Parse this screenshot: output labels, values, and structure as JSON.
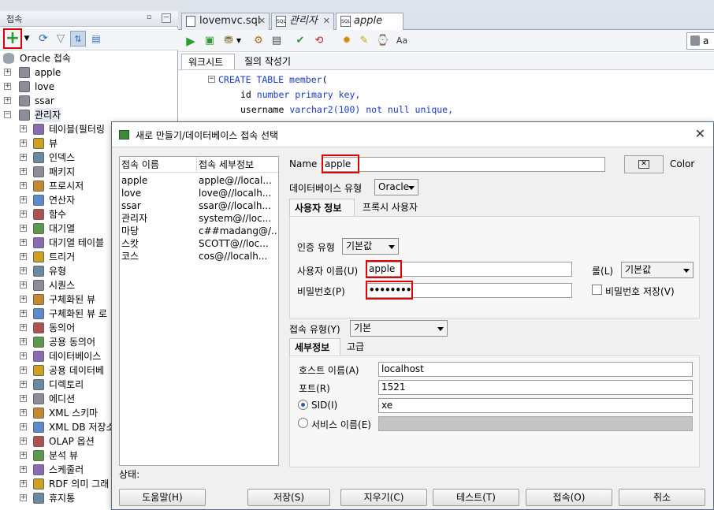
{
  "connections_panel": {
    "title": "접속",
    "minimize": "－",
    "tree": [
      {
        "label": "Oracle 접속",
        "level": 0,
        "icon": "database-icon",
        "expander": ""
      },
      {
        "label": "apple",
        "level": 1,
        "icon": "connection-icon",
        "expander": "+"
      },
      {
        "label": "love",
        "level": 1,
        "icon": "connection-icon",
        "expander": "+"
      },
      {
        "label": "ssar",
        "level": 1,
        "icon": "connection-icon",
        "expander": "+"
      },
      {
        "label": "관리자",
        "level": 1,
        "icon": "connection-icon",
        "expander": "−"
      },
      {
        "label": "테이블(필터링",
        "level": 2,
        "icon": "table-icon",
        "expander": "+"
      },
      {
        "label": "뷰",
        "level": 2,
        "icon": "view-icon",
        "expander": "+"
      },
      {
        "label": "인덱스",
        "level": 2,
        "icon": "index-icon",
        "expander": "+"
      },
      {
        "label": "패키지",
        "level": 2,
        "icon": "package-icon",
        "expander": "+"
      },
      {
        "label": "프로시저",
        "level": 2,
        "icon": "procedure-icon",
        "expander": "+"
      },
      {
        "label": "연산자",
        "level": 2,
        "icon": "operator-icon",
        "expander": "+"
      },
      {
        "label": "함수",
        "level": 2,
        "icon": "function-icon",
        "expander": "+"
      },
      {
        "label": "대기열",
        "level": 2,
        "icon": "queue-icon",
        "expander": "+"
      },
      {
        "label": "대기열 테이블",
        "level": 2,
        "icon": "queue-table-icon",
        "expander": "+"
      },
      {
        "label": "트리거",
        "level": 2,
        "icon": "trigger-icon",
        "expander": "+"
      },
      {
        "label": "유형",
        "level": 2,
        "icon": "type-icon",
        "expander": "+"
      },
      {
        "label": "시퀀스",
        "level": 2,
        "icon": "sequence-icon",
        "expander": "+"
      },
      {
        "label": "구체화된 뷰",
        "level": 2,
        "icon": "mview-icon",
        "expander": "+"
      },
      {
        "label": "구체화된 뷰 로",
        "level": 2,
        "icon": "mview-log-icon",
        "expander": "+"
      },
      {
        "label": "동의어",
        "level": 2,
        "icon": "synonym-icon",
        "expander": "+"
      },
      {
        "label": "공용 동의어",
        "level": 2,
        "icon": "public-synonym-icon",
        "expander": "+"
      },
      {
        "label": "데이터베이스",
        "level": 2,
        "icon": "db-link-icon",
        "expander": "+"
      },
      {
        "label": "공용 데이터베",
        "level": 2,
        "icon": "public-db-link-icon",
        "expander": "+"
      },
      {
        "label": "디렉토리",
        "level": 2,
        "icon": "directory-icon",
        "expander": "+"
      },
      {
        "label": "에디션",
        "level": 2,
        "icon": "edition-icon",
        "expander": "+"
      },
      {
        "label": "XML 스키마",
        "level": 2,
        "icon": "xml-schema-icon",
        "expander": "+"
      },
      {
        "label": "XML DB 저장소",
        "level": 2,
        "icon": "xml-db-icon",
        "expander": "+"
      },
      {
        "label": "OLAP 옵션",
        "level": 2,
        "icon": "olap-icon",
        "expander": "+"
      },
      {
        "label": "분석 뷰",
        "level": 2,
        "icon": "analytic-view-icon",
        "expander": "+"
      },
      {
        "label": "스케줄러",
        "level": 2,
        "icon": "scheduler-icon",
        "expander": "+"
      },
      {
        "label": "RDF 의미 그래",
        "level": 2,
        "icon": "rdf-icon",
        "expander": "+"
      },
      {
        "label": "휴지통",
        "level": 2,
        "icon": "recycle-bin-icon",
        "expander": "+"
      }
    ]
  },
  "editor": {
    "tabs": [
      {
        "label": "lovemvc.sql",
        "italic": false
      },
      {
        "label": "관리자",
        "italic": true
      },
      {
        "label": "apple",
        "italic": true
      }
    ],
    "subtabs": [
      "워크시트",
      "질의 작성기"
    ],
    "connection_combo": "a",
    "code_lines": [
      {
        "kw1": "CREATE TABLE ",
        "ident": "member",
        "rest": "("
      },
      {
        "kw1": "",
        "ident": "id ",
        "rest": "number primary key,"
      },
      {
        "kw1": "",
        "ident": "username ",
        "rest": "varchar2(100) not null unique,"
      }
    ]
  },
  "dialog": {
    "title": "새로 만들기/데이터베이스 접속 선택",
    "close": "✕",
    "list_headers": [
      "접속 이름",
      "접속 세부정보"
    ],
    "list_rows": [
      [
        "apple",
        "apple@//local..."
      ],
      [
        "love",
        "love@//localh..."
      ],
      [
        "ssar",
        "ssar@//localh..."
      ],
      [
        "관리자",
        "system@//loc..."
      ],
      [
        "마당",
        "c##madang@/..."
      ],
      [
        "스캇",
        "SCOTT@//loc..."
      ],
      [
        "코스",
        "cos@//localh..."
      ]
    ],
    "name_label": "Name",
    "name_value": "apple",
    "color_label": "Color",
    "db_type_label": "데이터베이스 유형",
    "db_type_value": "Oracle",
    "tab_user_info": "사용자 정보",
    "tab_proxy_user": "프록시 사용자",
    "auth_type_label": "인증 유형",
    "auth_type_value": "기본값",
    "username_label": "사용자 이름(U)",
    "username_value": "apple",
    "role_label": "롤(L)",
    "role_value": "기본값",
    "password_label": "비밀번호(P)",
    "password_value": "••••••••",
    "save_password_label": "비밀번호 저장(V)",
    "conn_type_label": "접속 유형(Y)",
    "conn_type_value": "기본",
    "tab_details": "세부정보",
    "tab_advanced": "고급",
    "host_label": "호스트 이름(A)",
    "host_value": "localhost",
    "port_label": "포트(R)",
    "port_value": "1521",
    "sid_label": "SID(I)",
    "sid_value": "xe",
    "service_label": "서비스 이름(E)",
    "service_value": "",
    "status_label": "상태:",
    "buttons": {
      "help": "도움말(H)",
      "save": "저장(S)",
      "clear": "지우기(C)",
      "test": "테스트(T)",
      "connect": "접속(O)",
      "cancel": "취소"
    }
  },
  "colors": {
    "highlight_box": "#e00000",
    "keyword": "#1a3bcd",
    "accent_green": "#2f9a2f"
  }
}
